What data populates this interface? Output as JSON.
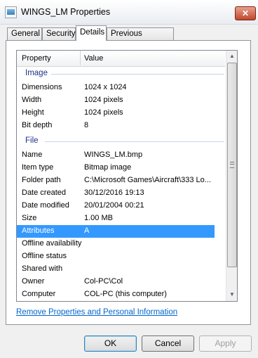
{
  "window": {
    "title": "WINGS_LM Properties",
    "close_glyph": "✕"
  },
  "tabs": [
    {
      "label": "General"
    },
    {
      "label": "Security"
    },
    {
      "label": "Details",
      "active": true
    },
    {
      "label": "Previous Versions"
    }
  ],
  "list": {
    "columns": {
      "property": "Property",
      "value": "Value"
    },
    "groups": [
      {
        "label": "Image",
        "rows": [
          {
            "property": "Dimensions",
            "value": "1024 x 1024"
          },
          {
            "property": "Width",
            "value": "1024 pixels"
          },
          {
            "property": "Height",
            "value": "1024 pixels"
          },
          {
            "property": "Bit depth",
            "value": "8"
          }
        ]
      },
      {
        "label": "File",
        "rows": [
          {
            "property": "Name",
            "value": "WINGS_LM.bmp"
          },
          {
            "property": "Item type",
            "value": "Bitmap image"
          },
          {
            "property": "Folder path",
            "value": "C:\\Microsoft Games\\Aircraft\\333 Lo..."
          },
          {
            "property": "Date created",
            "value": "30/12/2016 19:13"
          },
          {
            "property": "Date modified",
            "value": "20/01/2004 00:21"
          },
          {
            "property": "Size",
            "value": "1.00 MB"
          },
          {
            "property": "Attributes",
            "value": "A",
            "selected": true
          },
          {
            "property": "Offline availability",
            "value": ""
          },
          {
            "property": "Offline status",
            "value": ""
          },
          {
            "property": "Shared with",
            "value": ""
          },
          {
            "property": "Owner",
            "value": "Col-PC\\Col"
          },
          {
            "property": "Computer",
            "value": "COL-PC (this computer)"
          }
        ]
      }
    ],
    "selection_color": "#3399ff",
    "group_label_color": "#1e3287"
  },
  "scrollbar": {
    "up_icon": "▲",
    "down_icon": "▼"
  },
  "remove_link": "Remove Properties and Personal Information",
  "buttons": {
    "ok": "OK",
    "cancel": "Cancel",
    "apply": "Apply"
  }
}
